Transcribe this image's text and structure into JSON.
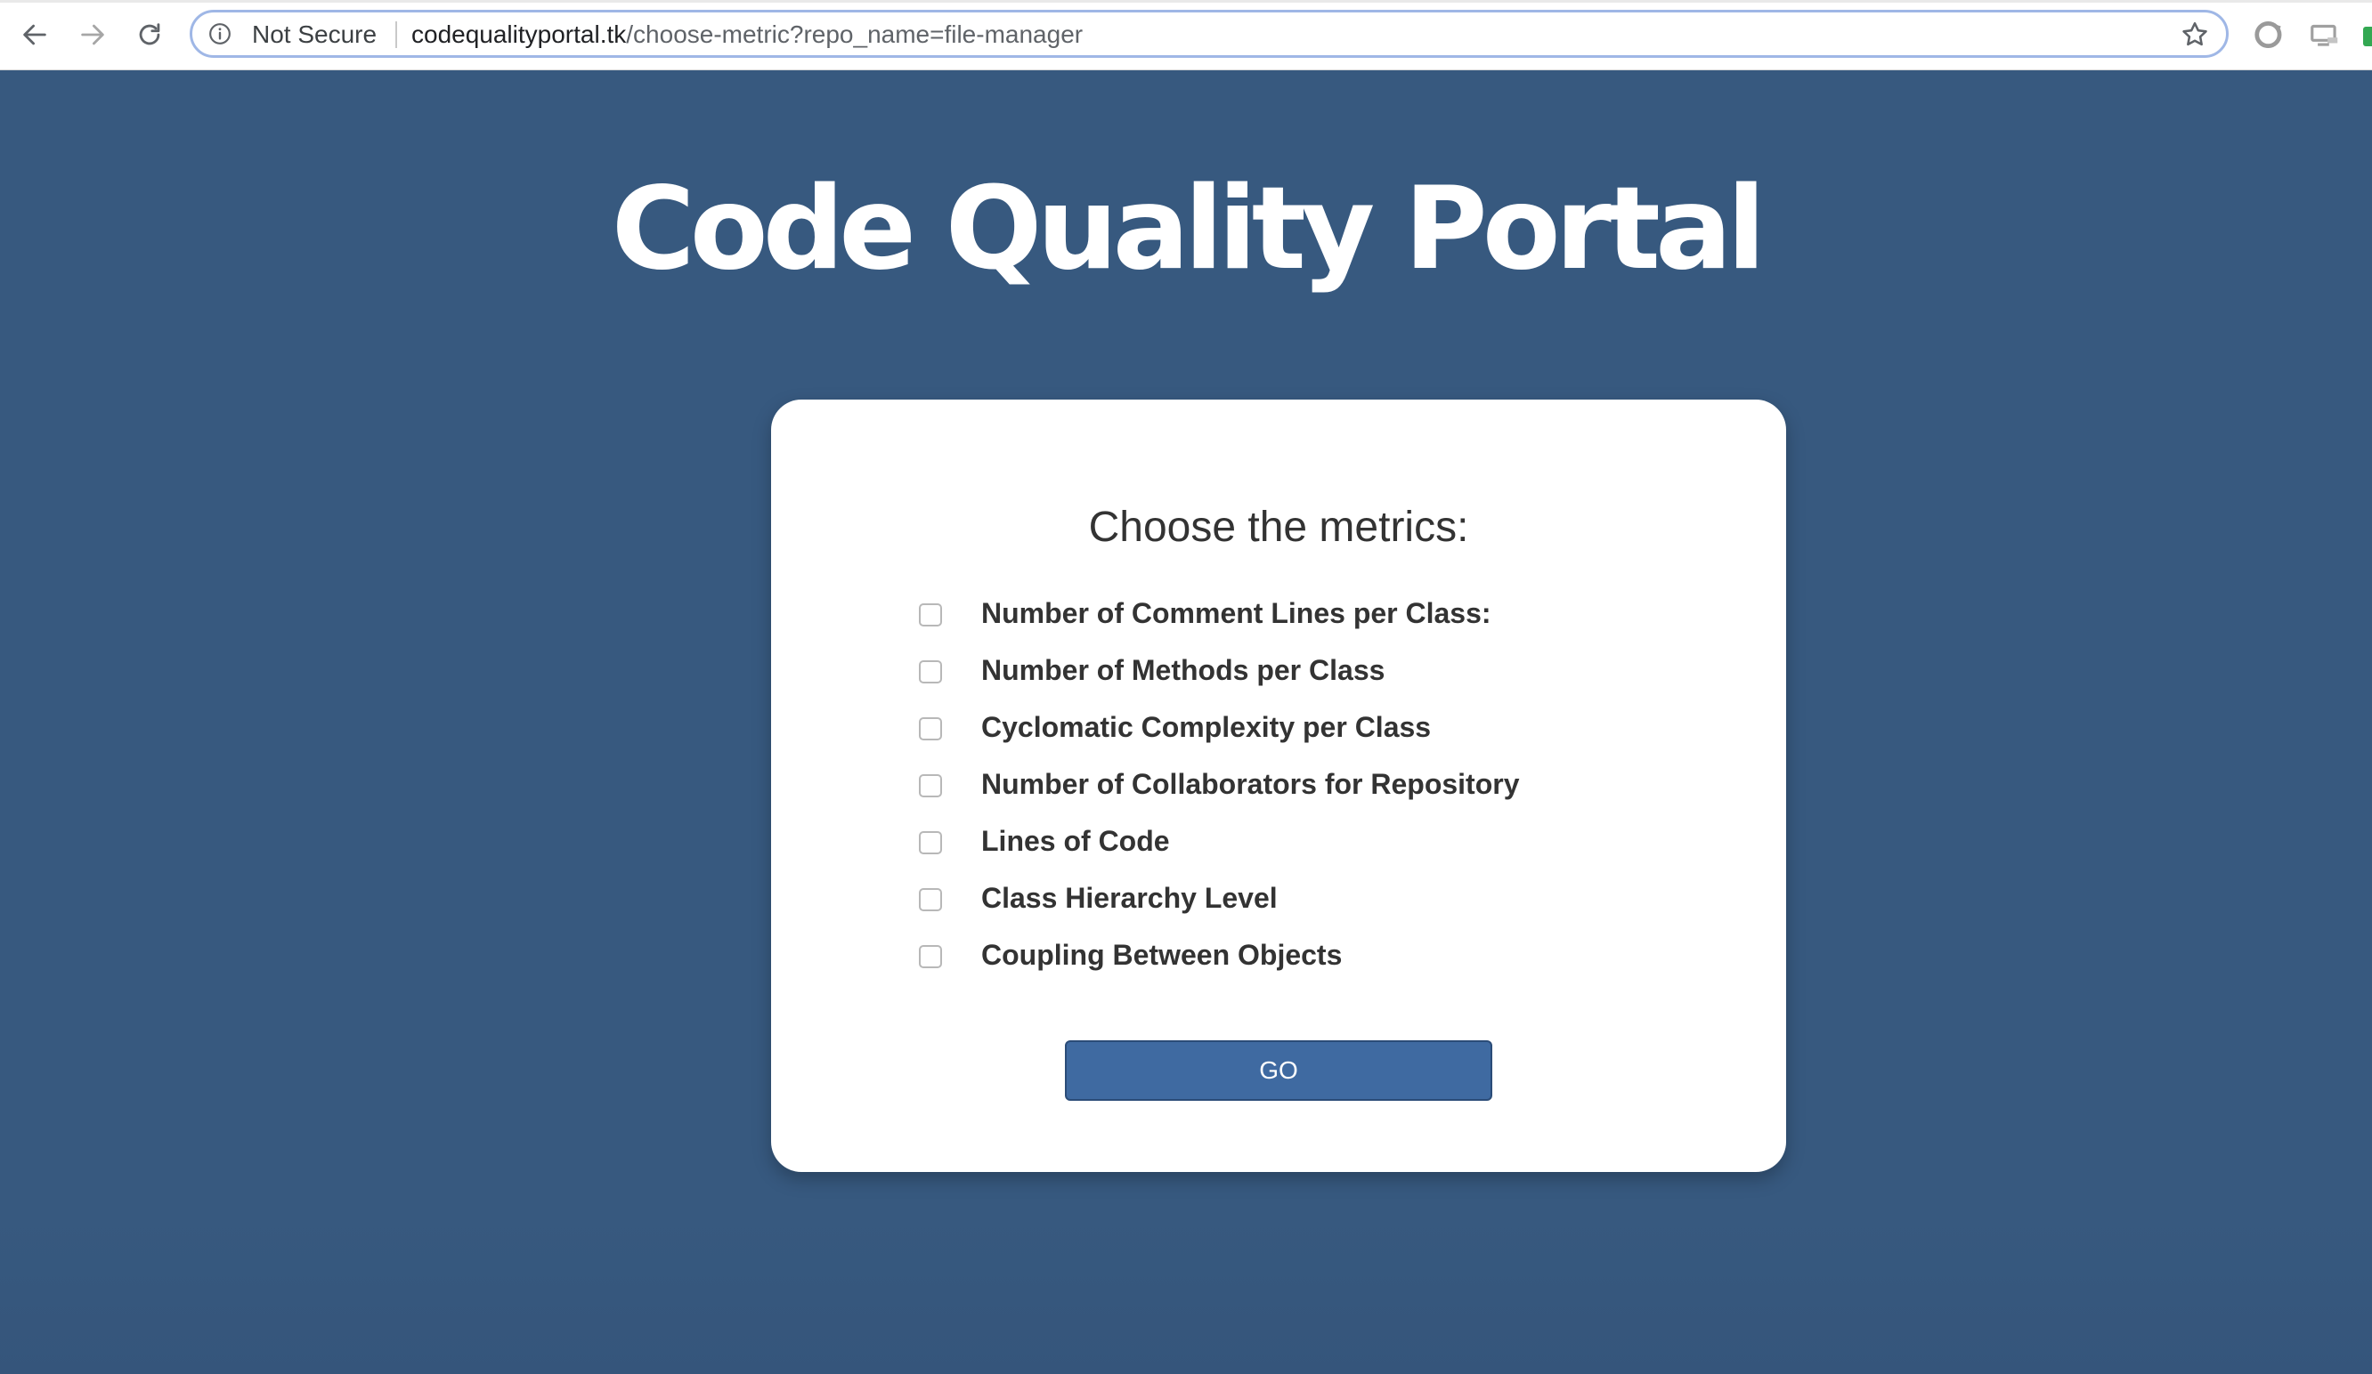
{
  "browser": {
    "security_label": "Not Secure",
    "url_host": "codequalityportal.tk",
    "url_path": "/choose-metric?repo_name=file-manager"
  },
  "page": {
    "title": "Code Quality Portal",
    "background_color": "#37597f"
  },
  "form": {
    "heading": "Choose the metrics:",
    "metrics": [
      {
        "label": "Number of Comment Lines per Class:",
        "checked": false
      },
      {
        "label": "Number of Methods per Class",
        "checked": false
      },
      {
        "label": "Cyclomatic Complexity per Class",
        "checked": false
      },
      {
        "label": "Number of Collaborators for Repository",
        "checked": false
      },
      {
        "label": "Lines of Code",
        "checked": false
      },
      {
        "label": "Class Hierarchy Level",
        "checked": false
      },
      {
        "label": "Coupling Between Objects",
        "checked": false
      }
    ],
    "submit_label": "GO",
    "submit_color": "#3f6aa1"
  }
}
